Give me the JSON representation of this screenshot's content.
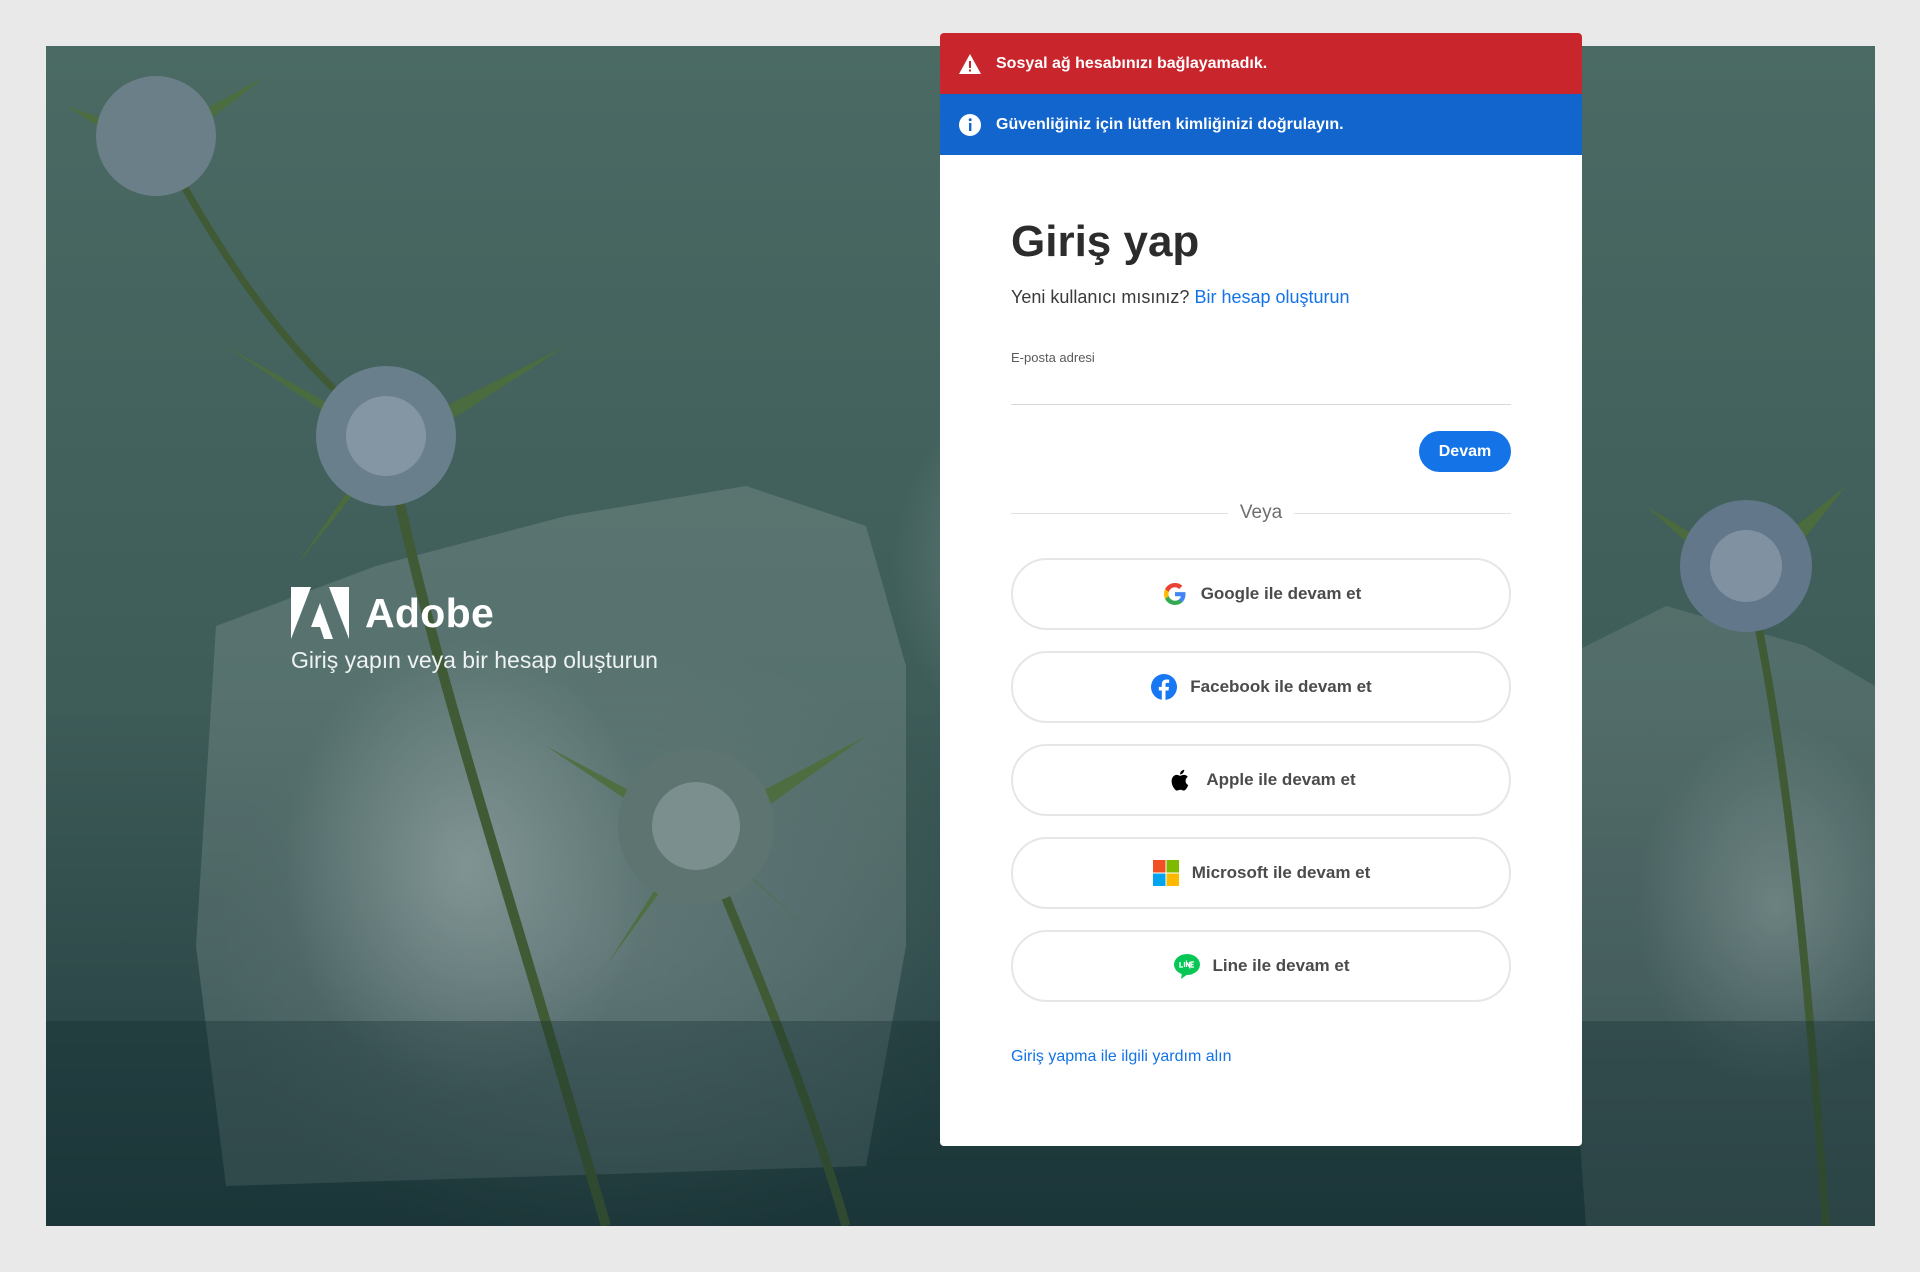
{
  "brand": {
    "name": "Adobe",
    "tagline": "Giriş yapın veya bir hesap oluşturun"
  },
  "alerts": {
    "error": "Sosyal ağ hesabınızı bağlayamadık.",
    "info": "Güvenliğiniz için lütfen kimliğinizi doğrulayın."
  },
  "signin": {
    "title": "Giriş yap",
    "new_user_prompt": "Yeni kullanıcı mısınız?",
    "create_account_link": "Bir hesap oluşturun",
    "email_label": "E-posta adresi",
    "email_value": "",
    "continue_label": "Devam",
    "divider_label": "Veya"
  },
  "social_buttons": {
    "google": "Google ile devam et",
    "facebook": "Facebook ile devam et",
    "apple": "Apple ile devam et",
    "microsoft": "Microsoft ile devam et",
    "line": "Line ile devam et"
  },
  "help_link": "Giriş yapma ile ilgili yardım alın",
  "colors": {
    "accent": "#1473e6",
    "error_banner": "#c9252d",
    "info_banner": "#1265cc"
  }
}
